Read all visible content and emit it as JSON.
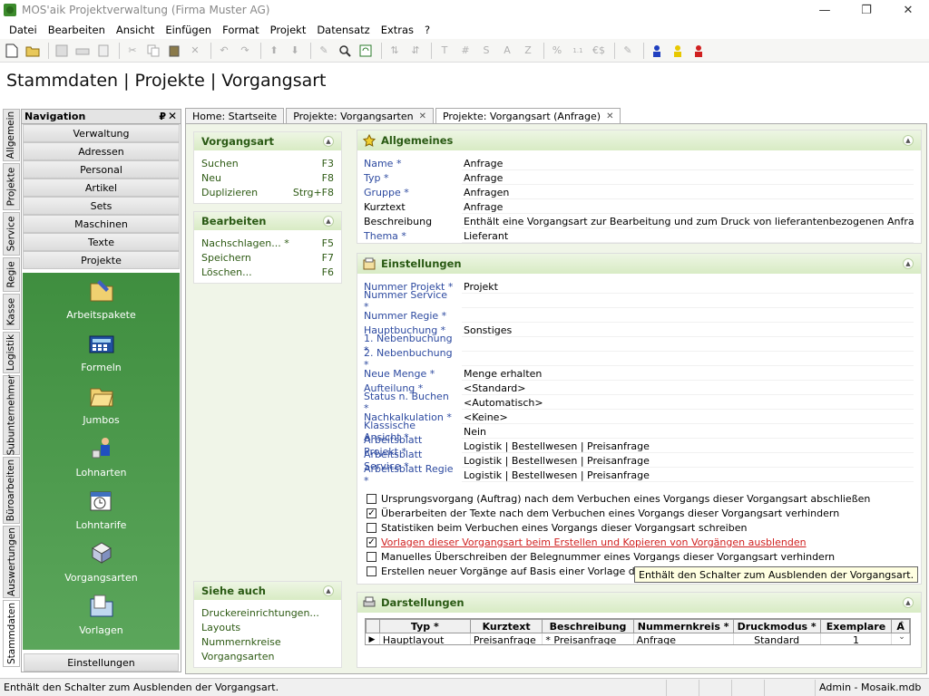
{
  "window": {
    "title": "MOS'aik Projektverwaltung (Firma Muster AG)",
    "minimize_glyph": "—",
    "maximize_glyph": "❐",
    "close_glyph": "✕"
  },
  "menu": [
    "Datei",
    "Bearbeiten",
    "Ansicht",
    "Einfügen",
    "Format",
    "Projekt",
    "Datensatz",
    "Extras",
    "?"
  ],
  "toolbar": {
    "text_buttons": [
      "T",
      "#",
      "S",
      "A",
      "Z",
      "%",
      "€$"
    ],
    "icons": [
      "new-icon",
      "open-icon",
      "save-icon",
      "print-icon",
      "cut-icon",
      "copy-icon",
      "paste-icon",
      "delete-icon",
      "undo-icon",
      "redo-icon",
      "up-icon",
      "down-icon",
      "edit-icon",
      "find-icon",
      "refresh-icon",
      "sort-asc-icon",
      "sort-desc-icon",
      "users-icon"
    ]
  },
  "heading": "Stammdaten | Projekte | Vorgangsart",
  "vertical_tabs": [
    "Allgemein",
    "Projekte",
    "Service",
    "Regie",
    "Kasse",
    "Logistik",
    "Subunternehmer",
    "Büroarbeiten",
    "Auswertungen",
    "Stammdaten"
  ],
  "navigation": {
    "title": "Navigation",
    "pin": "₽",
    "close": "✕",
    "buttons": [
      "Verwaltung",
      "Adressen",
      "Personal",
      "Artikel",
      "Sets",
      "Maschinen",
      "Texte",
      "Projekte"
    ],
    "items": [
      {
        "label": "Arbeitspakete",
        "icon": "folder-pencil-icon"
      },
      {
        "label": "Formeln",
        "icon": "calculator-icon"
      },
      {
        "label": "Jumbos",
        "icon": "folder-open-icon"
      },
      {
        "label": "Lohnarten",
        "icon": "worker-icon"
      },
      {
        "label": "Lohntarife",
        "icon": "calendar-clock-icon"
      },
      {
        "label": "Vorgangsarten",
        "icon": "puzzle-icon"
      },
      {
        "label": "Vorlagen",
        "icon": "folder-blue-icon"
      }
    ],
    "bottom_button": "Einstellungen"
  },
  "doc_tabs": [
    {
      "label": "Home: Startseite",
      "closable": false
    },
    {
      "label": "Projekte: Vorgangsarten",
      "closable": true
    },
    {
      "label": "Projekte: Vorgangsart (Anfrage)",
      "closable": true,
      "active": true
    }
  ],
  "actions": {
    "vorgangsart": {
      "title": "Vorgangsart",
      "items": [
        {
          "label": "Suchen",
          "key": "F3"
        },
        {
          "label": "Neu",
          "key": "F8"
        },
        {
          "label": "Duplizieren",
          "key": "Strg+F8"
        }
      ]
    },
    "bearbeiten": {
      "title": "Bearbeiten",
      "items": [
        {
          "label": "Nachschlagen... *",
          "key": "F5"
        },
        {
          "label": "Speichern",
          "key": "F7"
        },
        {
          "label": "Löschen...",
          "key": "F6"
        }
      ]
    },
    "siehe_auch": {
      "title": "Siehe auch",
      "items": [
        {
          "label": "Druckereinrichtungen..."
        },
        {
          "label": "Layouts"
        },
        {
          "label": "Nummernkreise"
        },
        {
          "label": "Vorgangsarten"
        }
      ]
    }
  },
  "allgemeines": {
    "title": "Allgemeines",
    "fields": [
      {
        "label": "Name *",
        "value": "Anfrage",
        "required": true
      },
      {
        "label": "Typ *",
        "value": "Anfrage",
        "required": true
      },
      {
        "label": "Gruppe *",
        "value": "Anfragen",
        "required": true
      },
      {
        "label": "Kurztext",
        "value": "Anfrage",
        "required": false
      },
      {
        "label": "Beschreibung",
        "value": "Enthält eine Vorgangsart zur Bearbeitung und zum Druck von lieferantenbezogenen Anfragen.",
        "required": false
      },
      {
        "label": "Thema *",
        "value": "Lieferant",
        "required": true
      }
    ]
  },
  "einstellungen": {
    "title": "Einstellungen",
    "fields": [
      {
        "label": "Nummer Projekt *",
        "value": "Projekt"
      },
      {
        "label": "Nummer Service *",
        "value": ""
      },
      {
        "label": "Nummer Regie *",
        "value": ""
      },
      {
        "label": "Hauptbuchung *",
        "value": "Sonstiges"
      },
      {
        "label": "1. Nebenbuchung *",
        "value": ""
      },
      {
        "label": "2. Nebenbuchung *",
        "value": ""
      },
      {
        "label": "Neue Menge *",
        "value": "Menge erhalten"
      },
      {
        "label": "Aufteilung *",
        "value": "<Standard>"
      },
      {
        "label": "Status n. Buchen *",
        "value": "<Automatisch>"
      },
      {
        "label": "Nachkalkulation *",
        "value": "<Keine>"
      },
      {
        "label": "Klassische Ansicht *",
        "value": "Nein"
      },
      {
        "label": "Arbeitsblatt Projekt *",
        "value": "Logistik | Bestellwesen | Preisanfrage"
      },
      {
        "label": "Arbeitsblatt Service *",
        "value": "Logistik | Bestellwesen | Preisanfrage"
      },
      {
        "label": "Arbeitsblatt Regie *",
        "value": "Logistik | Bestellwesen | Preisanfrage"
      }
    ],
    "checkboxes": [
      {
        "label": "Ursprungsvorgang (Auftrag) nach dem Verbuchen eines Vorgangs dieser Vorgangsart abschließen",
        "checked": false,
        "mark": ""
      },
      {
        "label": "Überarbeiten der Texte nach dem Verbuchen eines Vorgangs dieser Vorgangsart verhindern",
        "checked": true,
        "mark": "✓"
      },
      {
        "label": "Statistiken beim Verbuchen eines Vorgangs dieser Vorgangsart schreiben",
        "checked": false,
        "mark": ""
      },
      {
        "label": "Vorlagen dieser Vorgangsart beim Erstellen und Kopieren von Vorgängen ausblenden",
        "checked": true,
        "mark": "✓",
        "highlight": true
      },
      {
        "label": "Manuelles Überschreiben der Belegnummer eines Vorgangs dieser Vorgangsart verhindern",
        "checked": false,
        "mark": ""
      },
      {
        "label": "Erstellen neuer Vorgänge auf Basis einer Vorlage dieser Vo",
        "checked": false,
        "mark": ""
      }
    ]
  },
  "darstellungen": {
    "title": "Darstellungen",
    "columns": [
      "Typ *",
      "Kurztext",
      "Beschreibung",
      "Nummernkreis *",
      "Druckmodus *",
      "Exemplare",
      "A"
    ],
    "rows": [
      {
        "marker": "▶",
        "cells": [
          "Hauptlayout",
          "Preisanfrage",
          "* Preisanfrage",
          "Anfrage",
          "Standard",
          "1",
          ""
        ]
      }
    ]
  },
  "tooltip": "Enthält den Schalter zum Ausblenden der Vorgangsart.",
  "statusbar": {
    "message": "Enthält den Schalter zum Ausblenden der Vorgangsart.",
    "user_db": "Admin - Mosaik.mdb"
  },
  "colors": {
    "accent_green": "#2a5a14",
    "nav_green": "#4a9a4a",
    "link_blue": "#2d4aa0",
    "highlight_red": "#d02020"
  }
}
